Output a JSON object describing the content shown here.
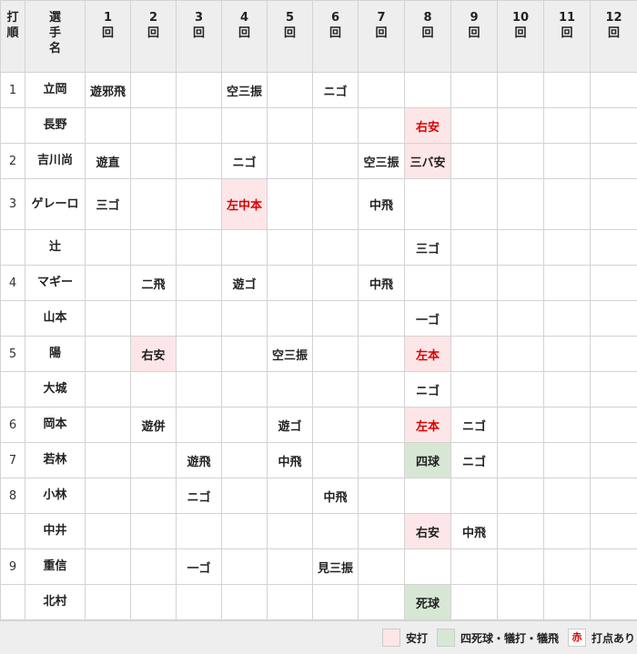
{
  "header": {
    "order": [
      "打",
      "順"
    ],
    "player": [
      "選",
      "手",
      "名"
    ],
    "innings": [
      [
        "1",
        "回"
      ],
      [
        "2",
        "回"
      ],
      [
        "3",
        "回"
      ],
      [
        "4",
        "回"
      ],
      [
        "5",
        "回"
      ],
      [
        "6",
        "回"
      ],
      [
        "7",
        "回"
      ],
      [
        "8",
        "回"
      ],
      [
        "9",
        "回"
      ],
      [
        "10",
        "回"
      ],
      [
        "11",
        "回"
      ],
      [
        "12",
        "回"
      ]
    ]
  },
  "rows": [
    {
      "order": "1",
      "name": "立岡",
      "cells": [
        {
          "t": "遊邪飛"
        },
        {},
        {},
        {
          "t": "空三振"
        },
        {},
        {
          "t": "ニゴ"
        },
        {},
        {},
        {},
        {},
        {},
        {}
      ]
    },
    {
      "order": "",
      "name": "長野",
      "cells": [
        {},
        {},
        {},
        {},
        {},
        {},
        {},
        {
          "t": "右安",
          "k": "hit",
          "rbi": true
        },
        {},
        {},
        {},
        {}
      ]
    },
    {
      "order": "2",
      "name": "吉川尚",
      "cells": [
        {
          "t": "遊直"
        },
        {},
        {},
        {
          "t": "ニゴ"
        },
        {},
        {},
        {
          "t": "空三振"
        },
        {
          "t": "三バ安",
          "k": "hit"
        },
        {},
        {},
        {},
        {}
      ]
    },
    {
      "order": "3",
      "name": "ゲレーロ",
      "tall": true,
      "cells": [
        {
          "t": "三ゴ"
        },
        {},
        {},
        {
          "t": "左中本",
          "k": "hit",
          "rbi": true
        },
        {},
        {},
        {
          "t": "中飛"
        },
        {},
        {},
        {},
        {},
        {}
      ]
    },
    {
      "order": "",
      "name": "辻",
      "cells": [
        {},
        {},
        {},
        {},
        {},
        {},
        {},
        {
          "t": "三ゴ"
        },
        {},
        {},
        {},
        {}
      ]
    },
    {
      "order": "4",
      "name": "マギー",
      "cells": [
        {},
        {
          "t": "二飛"
        },
        {},
        {
          "t": "遊ゴ"
        },
        {},
        {},
        {
          "t": "中飛"
        },
        {},
        {},
        {},
        {},
        {}
      ]
    },
    {
      "order": "",
      "name": "山本",
      "cells": [
        {},
        {},
        {},
        {},
        {},
        {},
        {},
        {
          "t": "一ゴ"
        },
        {},
        {},
        {},
        {}
      ]
    },
    {
      "order": "5",
      "name": "陽",
      "cells": [
        {},
        {
          "t": "右安",
          "k": "hit"
        },
        {},
        {},
        {
          "t": "空三振"
        },
        {},
        {},
        {
          "t": "左本",
          "k": "hit",
          "rbi": true
        },
        {},
        {},
        {},
        {}
      ]
    },
    {
      "order": "",
      "name": "大城",
      "cells": [
        {},
        {},
        {},
        {},
        {},
        {},
        {},
        {
          "t": "ニゴ"
        },
        {},
        {},
        {},
        {}
      ]
    },
    {
      "order": "6",
      "name": "岡本",
      "cells": [
        {},
        {
          "t": "遊併"
        },
        {},
        {},
        {
          "t": "遊ゴ"
        },
        {},
        {},
        {
          "t": "左本",
          "k": "hit",
          "rbi": true
        },
        {
          "t": "ニゴ"
        },
        {},
        {},
        {}
      ]
    },
    {
      "order": "7",
      "name": "若林",
      "cells": [
        {},
        {},
        {
          "t": "遊飛"
        },
        {},
        {
          "t": "中飛"
        },
        {},
        {},
        {
          "t": "四球",
          "k": "walk"
        },
        {
          "t": "ニゴ"
        },
        {},
        {},
        {}
      ]
    },
    {
      "order": "8",
      "name": "小林",
      "cells": [
        {},
        {},
        {
          "t": "ニゴ"
        },
        {},
        {},
        {
          "t": "中飛"
        },
        {},
        {},
        {},
        {},
        {},
        {}
      ]
    },
    {
      "order": "",
      "name": "中井",
      "cells": [
        {},
        {},
        {},
        {},
        {},
        {},
        {},
        {
          "t": "右安",
          "k": "hit"
        },
        {
          "t": "中飛"
        },
        {},
        {},
        {}
      ]
    },
    {
      "order": "9",
      "name": "重信",
      "cells": [
        {},
        {},
        {
          "t": "一ゴ"
        },
        {},
        {},
        {
          "t": "見三振"
        },
        {},
        {},
        {},
        {},
        {},
        {}
      ]
    },
    {
      "order": "",
      "name": "北村",
      "cells": [
        {},
        {},
        {},
        {},
        {},
        {},
        {},
        {
          "t": "死球",
          "k": "walk"
        },
        {},
        {},
        {},
        {}
      ]
    }
  ],
  "legend": {
    "hit_label": "安打",
    "walk_label": "四死球・犠打・犠飛",
    "red_sample": "赤",
    "red_label": "打点あり"
  },
  "colors": {
    "hit_bg": "#fde6e8",
    "walk_bg": "#d6e8d3",
    "rbi_text": "#dd0000",
    "header_bg": "#eeeeee"
  }
}
